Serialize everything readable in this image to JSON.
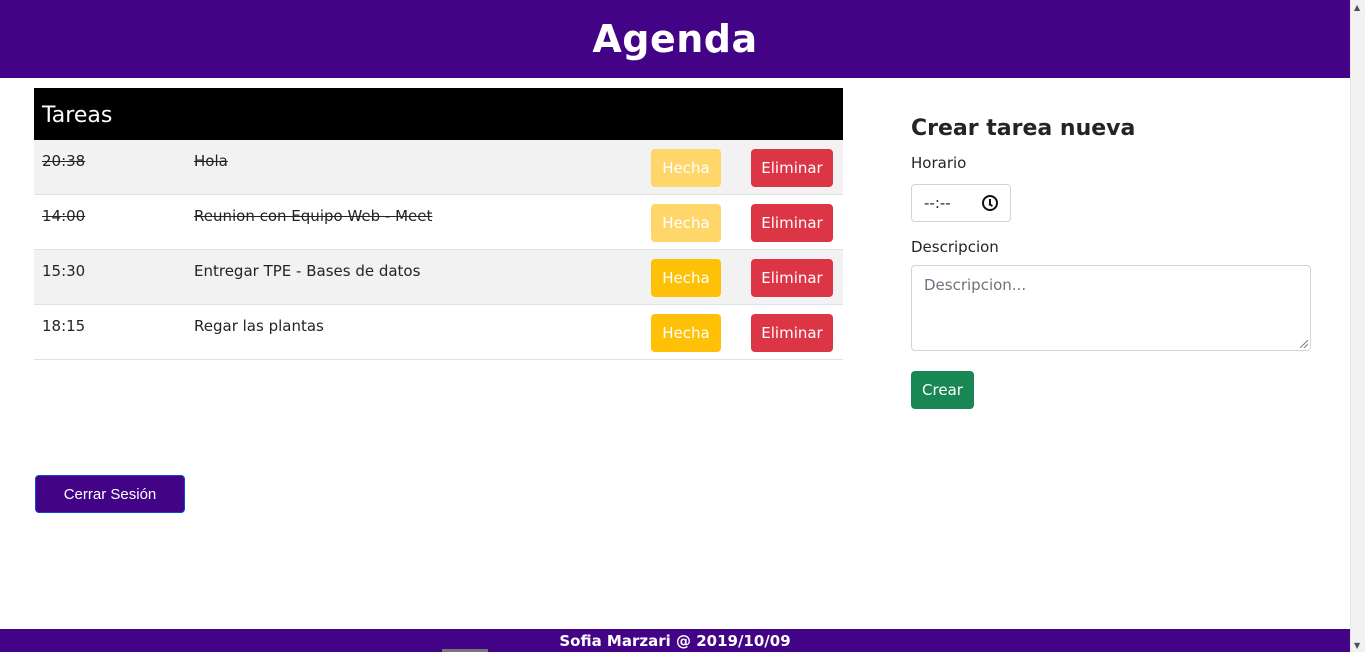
{
  "header": {
    "title": "Agenda"
  },
  "tasks": {
    "heading": "Tareas",
    "rows": [
      {
        "time": "20:38",
        "desc": "Hola",
        "done_label": "Hecha",
        "delete_label": "Eliminar"
      },
      {
        "time": "14:00",
        "desc": "Reunion con Equipo Web - Meet",
        "done_label": "Hecha",
        "delete_label": "Eliminar"
      },
      {
        "time": "15:30",
        "desc": "Entregar TPE - Bases de datos",
        "done_label": "Hecha",
        "delete_label": "Eliminar"
      },
      {
        "time": "18:15",
        "desc": "Regar las plantas",
        "done_label": "Hecha",
        "delete_label": "Eliminar"
      }
    ]
  },
  "logout": {
    "label": "Cerrar Sesión"
  },
  "form": {
    "title": "Crear tarea nueva",
    "time_label": "Horario",
    "time_value": "--:--",
    "desc_label": "Descripcion",
    "desc_placeholder": "Descripcion...",
    "submit_label": "Crear"
  },
  "footer": {
    "text": "Sofia Marzari @ 2019/10/09"
  },
  "colors": {
    "brand": "#430386",
    "warning": "#ffc107",
    "danger": "#dc3545",
    "success": "#198754"
  },
  "icons": {
    "time_input": "clock-icon"
  }
}
